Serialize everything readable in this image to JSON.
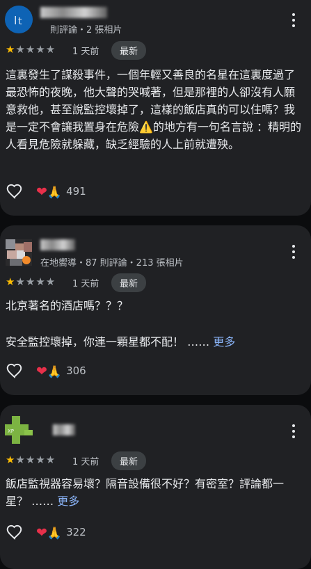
{
  "reviews": [
    {
      "subline": "則評論・2 張相片",
      "stars": "★",
      "stars_off": "★★★★",
      "date": "1 天前",
      "badge": "最新",
      "text": "這裏發生了謀殺事件，一個年輕又善良的名星在這裏度過了最恐怖的夜晚，他大聲的哭喊著，但是那裡的人卻沒有人願意救他，甚至說監控壞掉了，這樣的飯店真的可以住嗎？我是一定不會讓我置身在危險⚠️的地方有一句名言說 ：精明的人看見危險就躲藏，缺乏經驗的人上前就遭殃。",
      "reaction_icons": [
        "❤",
        "🙏"
      ],
      "reaction_count": "491"
    },
    {
      "subline": "在地嚮導・87 則評論・213 張相片",
      "stars": "★",
      "stars_off": "★★★★",
      "date": "1 天前",
      "badge": "最新",
      "text_line1": "北京著名的酒店嗎？？？",
      "text_line2": "安全監控壞掉，你連一顆星都不配！ ……",
      "more": "更多",
      "reaction_icons": [
        "❤",
        "🙏"
      ],
      "reaction_count": "306"
    },
    {
      "stars": "★",
      "stars_off": "★★★★",
      "date": "1 天前",
      "badge": "最新",
      "text": "飯店監視器容易壞？隔音設備很不好？有密室？評論都一星？ ……",
      "more": "更多",
      "reaction_icons": [
        "❤",
        "🙏"
      ],
      "reaction_count": "322"
    }
  ],
  "colors": {
    "card_bg": "#202124",
    "star_on": "#fbbc04",
    "star_off": "#9aa0a6",
    "link": "#8ab4f8",
    "heart_red": "#e8304a"
  },
  "icons": {
    "like": "heart-outline-icon",
    "menu": "more-vert-icon"
  }
}
